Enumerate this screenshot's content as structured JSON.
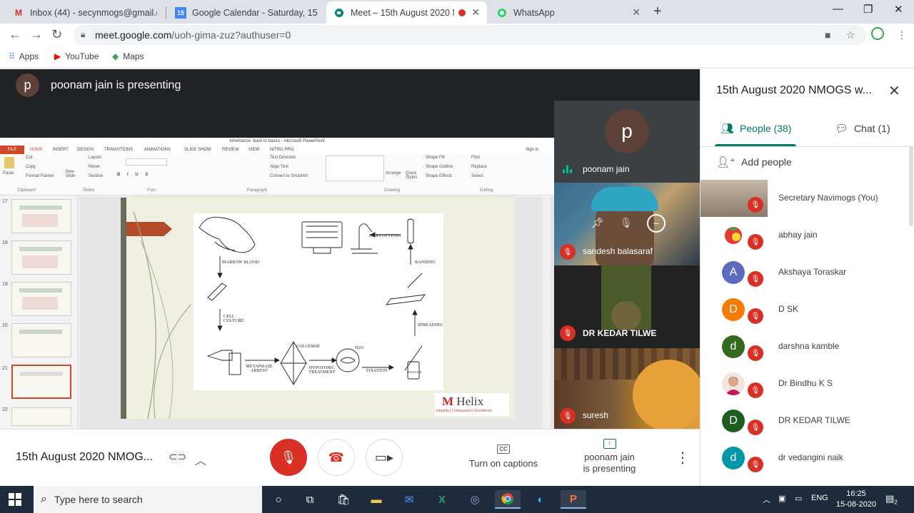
{
  "browser": {
    "tabs": [
      {
        "title": "Inbox (44) - secynmogs@gmail.c",
        "icon": "gmail-icon"
      },
      {
        "title": "Google Calendar - Saturday, 15 A",
        "icon": "calendar-icon",
        "icon_text": "15"
      },
      {
        "title": "Meet – 15th August 2020 N",
        "icon": "meet-icon",
        "active": true
      },
      {
        "title": "WhatsApp",
        "icon": "whatsapp-icon"
      }
    ],
    "url_host": "meet.google.com",
    "url_path": "/uoh-gima-zuz?authuser=0",
    "bookmarks": [
      {
        "label": "Apps",
        "icon": "apps-grid-icon"
      },
      {
        "label": "YouTube",
        "icon": "youtube-icon"
      },
      {
        "label": "Maps",
        "icon": "maps-icon"
      }
    ]
  },
  "presenter": {
    "initial": "p",
    "banner_text": "poonam jain is presenting"
  },
  "ppt": {
    "window_title": "Inheritance -back to basics - Microsoft PowerPoint",
    "menu": [
      "FILE",
      "HOME",
      "INSERT",
      "DESIGN",
      "TRANSITIONS",
      "ANIMATIONS",
      "SLIDE SHOW",
      "REVIEW",
      "VIEW",
      "NITRO PRO"
    ],
    "sign_in": "Sign in",
    "ribbon": {
      "cut": "Cut",
      "copy": "Copy",
      "format_painter": "Format Painter",
      "paste": "Paste",
      "new_slide": "New Slide",
      "layout": "Layout",
      "reset": "Reset",
      "section": "Section",
      "text_direction": "Text Direction",
      "align_text": "Align Text",
      "convert_smartart": "Convert to SmartArt",
      "arrange": "Arrange",
      "quick_styles": "Quick Styles",
      "shape_fill": "Shape Fill",
      "shape_outline": "Shape Outline",
      "shape_effects": "Shape Effects",
      "find": "Find",
      "replace": "Replace",
      "select": "Select",
      "groups": [
        "Clipboard",
        "Slides",
        "Font",
        "Paragraph",
        "Drawing",
        "Editing"
      ]
    },
    "thumbnails": [
      "17",
      "18",
      "19",
      "20",
      "21",
      "22"
    ],
    "selected_thumbnail": "21",
    "diagram_labels": {
      "marrow_blood": "MARROW BLOOD",
      "cell_culture": "CELL CULTURE",
      "karyotyping": "KARYOTYPING",
      "banding": "BANDING",
      "spreading": "SPREADING",
      "colcemid": "COLCEMID",
      "metaphase_arrest": "METAPHASE ARREST",
      "hypotonic_treatment": "HYPOTONIC TREATMENT",
      "fixation": "FIXATION",
      "h2o": "H2O",
      "fixative_bottle": "FIXATIVE"
    },
    "helix_logo": "Helix",
    "helix_tagline": "Integrity | Compassion | Excellence"
  },
  "tiles": [
    {
      "name": "poonam jain",
      "initial": "p",
      "mic": "speaking"
    },
    {
      "name": "sandesh balasaraf",
      "mic": "muted"
    },
    {
      "name": "DR KEDAR TILWE",
      "mic": "muted"
    },
    {
      "name": "suresh",
      "mic": "muted"
    }
  ],
  "panel": {
    "title": "15th August 2020 NMOGS w...",
    "people_tab": "People (38)",
    "chat_tab": "Chat (1)",
    "add_people": "Add people",
    "people": [
      {
        "name": "Secretary Navimogs (You)",
        "avatar_type": "photo",
        "color": "#7a6a5a"
      },
      {
        "name": "abhay jain",
        "avatar_type": "photo",
        "color": "#e53935"
      },
      {
        "name": "Akshaya Toraskar",
        "initial": "A",
        "color": "#5c6bc0"
      },
      {
        "name": "D SK",
        "initial": "D",
        "color": "#f57c00"
      },
      {
        "name": "darshna kamble",
        "initial": "d",
        "color": "#33691e"
      },
      {
        "name": "Dr Bindhu K S",
        "avatar_type": "photo",
        "color": "#d7a88a"
      },
      {
        "name": "DR KEDAR TILWE",
        "initial": "D",
        "color": "#1b5e20"
      },
      {
        "name": "dr vedangini naik",
        "initial": "d",
        "color": "#0097a7"
      }
    ]
  },
  "controls": {
    "meeting_title": "15th August 2020 NMOG...",
    "captions": "Turn on captions",
    "cc": "CC",
    "presenting_line1": "poonam jain",
    "presenting_line2": "is presenting"
  },
  "taskbar": {
    "search_placeholder": "Type here to search",
    "language": "ENG",
    "time": "16:25",
    "date": "15-08-2020",
    "notifications": "2"
  }
}
